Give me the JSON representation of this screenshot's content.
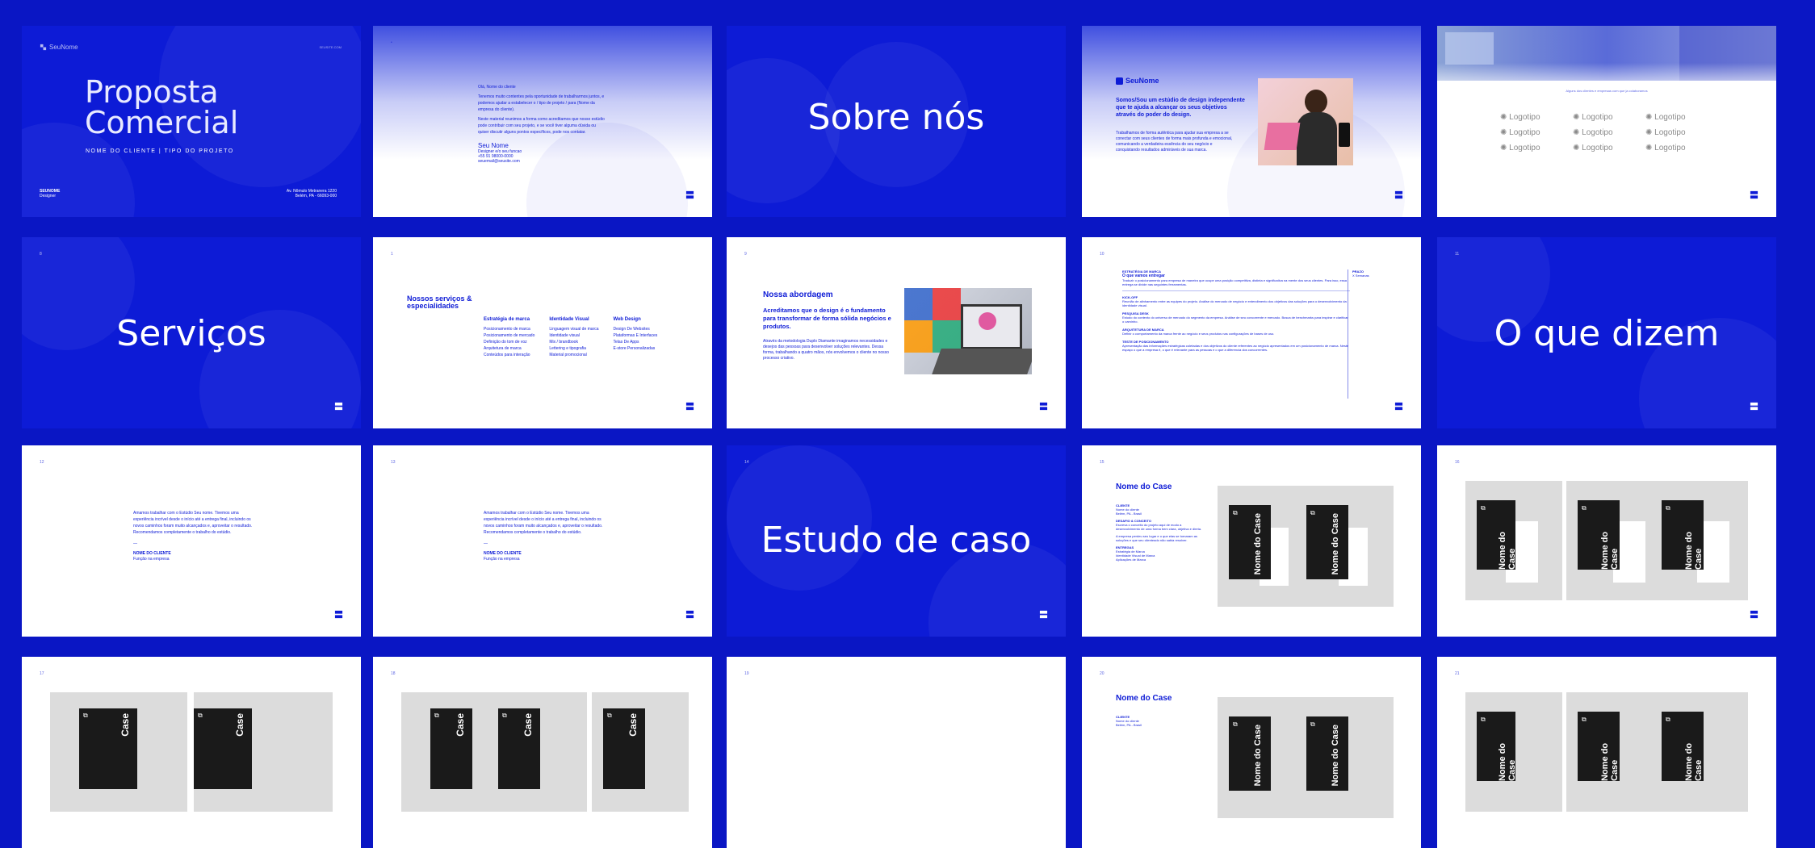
{
  "slides": {
    "s1": {
      "brand": "SeuNome",
      "site": "SEUSITE.COM",
      "title_l1": "Proposta",
      "title_l2": "Comercial",
      "subtitle": "NOME DO CLIENTE | TIPO DO PROJETO",
      "name": "SEUNOME",
      "role": "Designer",
      "addr1": "Av. Nômulo Metranera 1220",
      "addr2": "Belém, PA - 66093-000"
    },
    "s2": {
      "greeting": "Olá, Nome do cliente",
      "p1": "Tenemos muito contentes pela oportunidade de trabalharmos juntos, e podemos ajudar a estabelecer o / tipo de projeto / para (Nome da empresa do cliente).",
      "p2": "Neste material reunimos a forma como acreditamos que nosso estúdio pode contribuir com seu projeto, e se você tiver alguma dúvida ou quiser discutir alguns pontos específicos, pode nos contatar.",
      "sign": "Seu Nome",
      "c1": "Designer e/o seu funcao",
      "c2": "+55 91 98000-0000",
      "c3": "seuemail@seusite.com"
    },
    "s3": {
      "title": "Sobre nós"
    },
    "s4": {
      "brand": "SeuNome",
      "headline": "Somos/Sou um estúdio de design independente que te ajuda a alcançar os seus objetivos através do poder do design.",
      "body": "Trabalhamos de forma autêntica para ajudar sua empresa a se conectar com seus clientes de forma mais profunda e emocional, comunicando a verdadeira essência do seu negócio e conquistando resultados admiráveis de sua marca."
    },
    "s5": {
      "caption": "Alguns dos clientes e empresas com que ja colaboramos",
      "logos": [
        "Logotipo",
        "Logotipo",
        "Logotipo",
        "Logotipo",
        "Logotipo",
        "Logotipo",
        "Logotipo",
        "Logotipo",
        "Logotipo"
      ]
    },
    "s6": {
      "title": "Serviços",
      "num": "8"
    },
    "s7": {
      "num": "1",
      "heading": "Nossos serviços & especialidades",
      "cols": [
        {
          "title": "Estratégia de marca",
          "items": [
            "Posicionamento de marca",
            "Posicionamento de mercado",
            "Definição do tom de voz",
            "Arquitetura de marca",
            "Conteúdos para interação"
          ]
        },
        {
          "title": "Identidade Visual",
          "items": [
            "Linguagem visual de marca",
            "Identidade visual",
            "Mix / brandbook",
            "Lettering e tipografia",
            "Material promocional"
          ]
        },
        {
          "title": "Web Design",
          "items": [
            "Design De Websites",
            "Plataformas E Interfaces",
            "Telas De Apps",
            "E-store Personalizadas"
          ]
        }
      ]
    },
    "s8": {
      "num": "9",
      "title": "Nossa abordagem",
      "lead": "Acreditamos que o design é o fundamento para transformar de forma sólida negócios e produtos.",
      "body": "Através da metodologia Duplo Diamante imaginamos necessidades e desejos das pessoas para desenvolver soluções relevantes. Dessa forma, trabalhando a quatro mãos, nós envolvemos o cliente no nosso processo criativo."
    },
    "s9": {
      "num": "10",
      "right_title": "PRAZO",
      "right_val": "X Semanas",
      "blocks": [
        {
          "t": "ESTRATÉGIA DE MARCA",
          "s": "O que vamos entregar",
          "b": "Traduzir o posicionamento para empresa de maneira que ocupe uma posição competitiva, distinta e significativa na mente dos seus clientes. Para isso, essa entrega se divide nas seguintes ferramentas."
        },
        {
          "t": "KICK-OFF",
          "s": "",
          "b": "Reunião de alinhamento entre as equipes do projeto. Análise do mercado de negócio e entendimento dos objetivos das soluções para o desenvolvimento da identidade visual."
        },
        {
          "t": "PESQUISA DESK",
          "s": "",
          "b": "Estudo do contexto do universo de mercado do segmento da empresa. Análise de seu concorrente e mercado. Busca de benchmarks para inspirar e clarificar o caminho."
        },
        {
          "t": "ARQUITETURA DE MARCA",
          "s": "",
          "b": "Definir o comportamento da marca frente ao negócio e seus produtos nas configurações de bases de uso."
        },
        {
          "t": "TESTE DE POSICIONAMENTO",
          "s": "",
          "b": "Apresentação das informações estratégicas coletadas e dos objetivos do cliente referentes ao negócio apresentados em um posicionamento de marca. Neste espaço o que a empresa é, o que é relevante para as pessoas e o que a diferencia dos concorrentes."
        }
      ]
    },
    "s10": {
      "num": "11",
      "title": "O que dizem"
    },
    "s11": {
      "num": "12",
      "quote": "Amamos trabalhar com o Estúdio Seu nome. Tivemos uma experiência incrível desde o início até a entrega final, incluindo os novos caminhos foram muito alcançados e, aproveitar o resultado. Recomendamos completamente o trabalho do estúdio.",
      "dash": "—",
      "client": "NOME DO CLIENTE",
      "role": "Função na empresa"
    },
    "s12": {
      "num": "13",
      "quote": "Amamos trabalhar com o Estúdio Seu nome. Tivemos uma experiência incrível desde o início até a entrega final, incluindo os novos caminhos foram muito alcançados e, aproveitar o resultado. Recomendamos completamente o trabalho do estúdio.",
      "dash": "—",
      "client": "NOME DO CLIENTE",
      "role": "Função na empresa"
    },
    "s13": {
      "num": "14",
      "title": "Estudo de caso"
    },
    "s14": {
      "num": "15",
      "title": "Nome do Case",
      "l1": "CLIENTE",
      "v1a": "Nome do cliente",
      "v1b": "Belém, PA - Brasil",
      "l2": "DESAFIO & CONCEITO",
      "v2": "Escreva o conceito do projeto aqui de modo a desenvolvimento de uma forma bem clara, objetiva e direta.",
      "v3": "A empresa perdeu seu lugar e o que elas se tornaram as soluções e que seu clienteado não sabia resolver.",
      "l3": "ENTREGAS",
      "e1": "Estratégia de Marca",
      "e2": "Identidade Visual de Marca",
      "e3": "Aplicações de Marca",
      "card": "Nome do Case"
    },
    "s15": {
      "num": "16",
      "card": "Nome do Case"
    },
    "s16": {
      "num": "17",
      "card": "Case"
    },
    "s17": {
      "num": "18",
      "card": "Case"
    },
    "s18": {
      "num": "19"
    },
    "s19": {
      "num": "20",
      "title": "Nome do Case",
      "l1": "CLIENTE",
      "v1a": "Nome do cliente",
      "v1b": "Belém, PA - Brasil",
      "card": "Nome do Case"
    },
    "s20": {
      "num": "21",
      "card": "Nome do Case"
    }
  }
}
